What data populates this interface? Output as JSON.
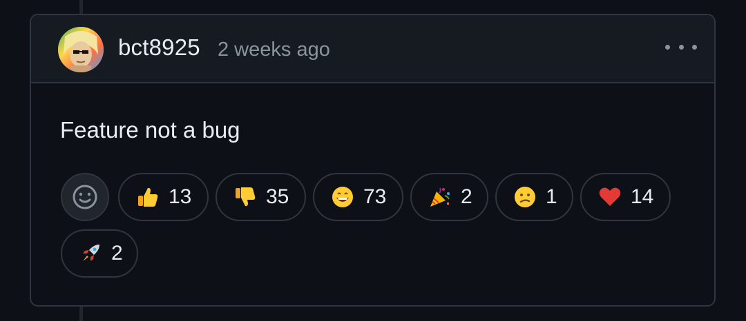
{
  "comment": {
    "author": "bct8925",
    "timestamp": "2 weeks ago",
    "body": "Feature not a bug"
  },
  "menu_icon": "kebab-horizontal-icon",
  "add_reaction_icon": "smiley-icon",
  "reactions": [
    {
      "name": "thumbs-up",
      "count": "13"
    },
    {
      "name": "thumbs-down",
      "count": "35"
    },
    {
      "name": "laugh",
      "count": "73"
    },
    {
      "name": "hooray",
      "count": "2"
    },
    {
      "name": "confused",
      "count": "1"
    },
    {
      "name": "heart",
      "count": "14"
    },
    {
      "name": "rocket",
      "count": "2"
    }
  ],
  "colors": {
    "background": "#0d1117",
    "header_background": "#161b22",
    "border": "#30363d",
    "text_primary": "#e6edf3",
    "text_muted": "#8b949e"
  }
}
